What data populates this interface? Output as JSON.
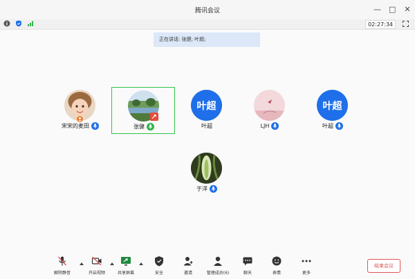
{
  "window": {
    "title": "腾讯会议"
  },
  "status": {
    "timer": "02:27:34"
  },
  "speaking_banner": "正在讲话: 张健; 叶超;",
  "participants": [
    {
      "name": "宋宋的麦田",
      "avatar": "photo-child",
      "selected": false,
      "host": true
    },
    {
      "name": "张健",
      "avatar": "photo-landscape",
      "selected": true,
      "sharing": true
    },
    {
      "name": "叶超",
      "avatar_text": "叶超",
      "selected": false
    },
    {
      "name": "LJH",
      "avatar": "photo-pink",
      "selected": false
    },
    {
      "name": "叶超",
      "avatar_text": "叶超",
      "selected": false
    },
    {
      "name": "于洋",
      "avatar": "photo-plant",
      "selected": false
    }
  ],
  "toolbar": {
    "mute": "解除静音",
    "video": "开启视频",
    "share": "共享屏幕",
    "security": "安全",
    "invite": "邀请",
    "members": "管理成员(6)",
    "chat": "聊天",
    "reactions": "表情",
    "more": "更多",
    "end": "结束会议"
  },
  "colors": {
    "accent": "#1e6fe9",
    "selected_border": "#2fc24b",
    "end": "#e05454",
    "banner": "#dce8f8"
  }
}
